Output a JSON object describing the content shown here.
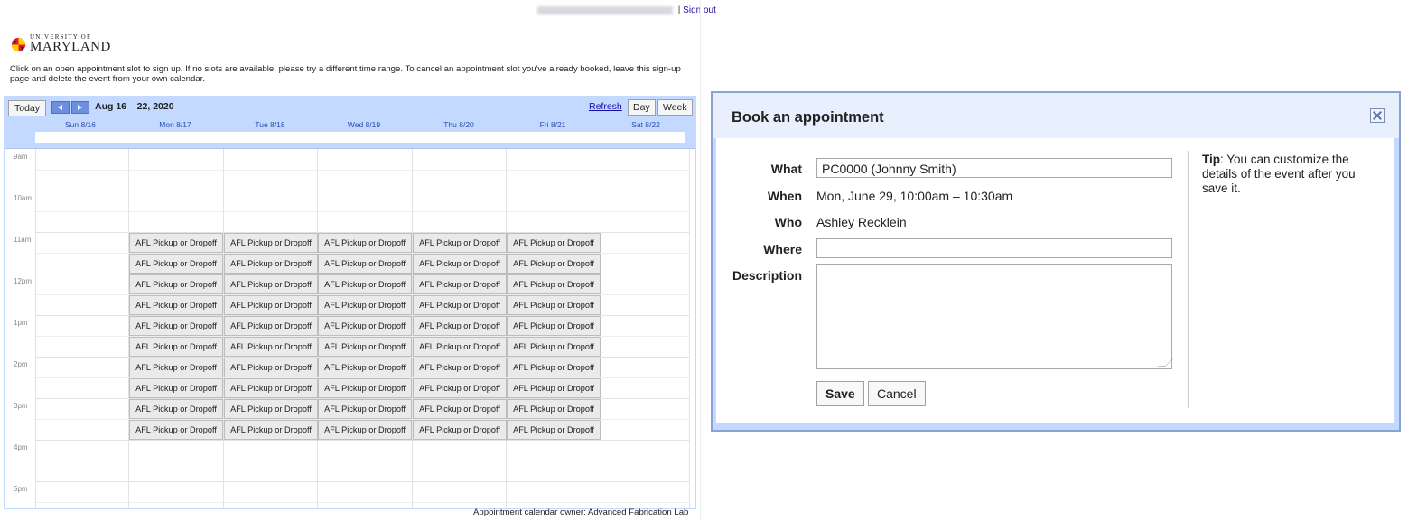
{
  "header": {
    "signout_label": "Sign out"
  },
  "brand": {
    "line1": "UNIVERSITY OF",
    "line2": "MARYLAND"
  },
  "intro": "Click on an open appointment slot to sign up. If no slots are available, please try a different time range. To cancel an appointment slot you've already booked, leave this sign-up page and delete the event from your own calendar.",
  "calendar": {
    "today_label": "Today",
    "date_range": "Aug 16 – 22, 2020",
    "refresh_label": "Refresh",
    "day_label": "Day",
    "week_label": "Week",
    "days": [
      "Sun 8/16",
      "Mon 8/17",
      "Tue 8/18",
      "Wed 8/19",
      "Thu 8/20",
      "Fri 8/21",
      "Sat 8/22"
    ],
    "hours": [
      "9am",
      "10am",
      "11am",
      "12pm",
      "1pm",
      "2pm",
      "3pm",
      "4pm",
      "5pm"
    ],
    "slot_label": "AFL Pickup or Dropoff",
    "owner_text": "Appointment calendar owner: Advanced Fabrication Lab"
  },
  "dialog": {
    "title": "Book an appointment",
    "what_label": "What",
    "what_value": "PC0000 (Johnny Smith)",
    "when_label": "When",
    "when_value": "Mon, June 29, 10:00am – 10:30am",
    "who_label": "Who",
    "who_value": "Ashley Recklein",
    "where_label": "Where",
    "where_value": "",
    "description_label": "Description",
    "save_label": "Save",
    "cancel_label": "Cancel",
    "tip_title": "Tip",
    "tip_text": ": You can customize the details of the event after you save it."
  },
  "colors": {
    "accent": "#c3d9ff",
    "link": "#1a0dab",
    "slot_bg": "#eaeaea",
    "brand_red": "#e21833",
    "brand_gold": "#ffd200"
  }
}
